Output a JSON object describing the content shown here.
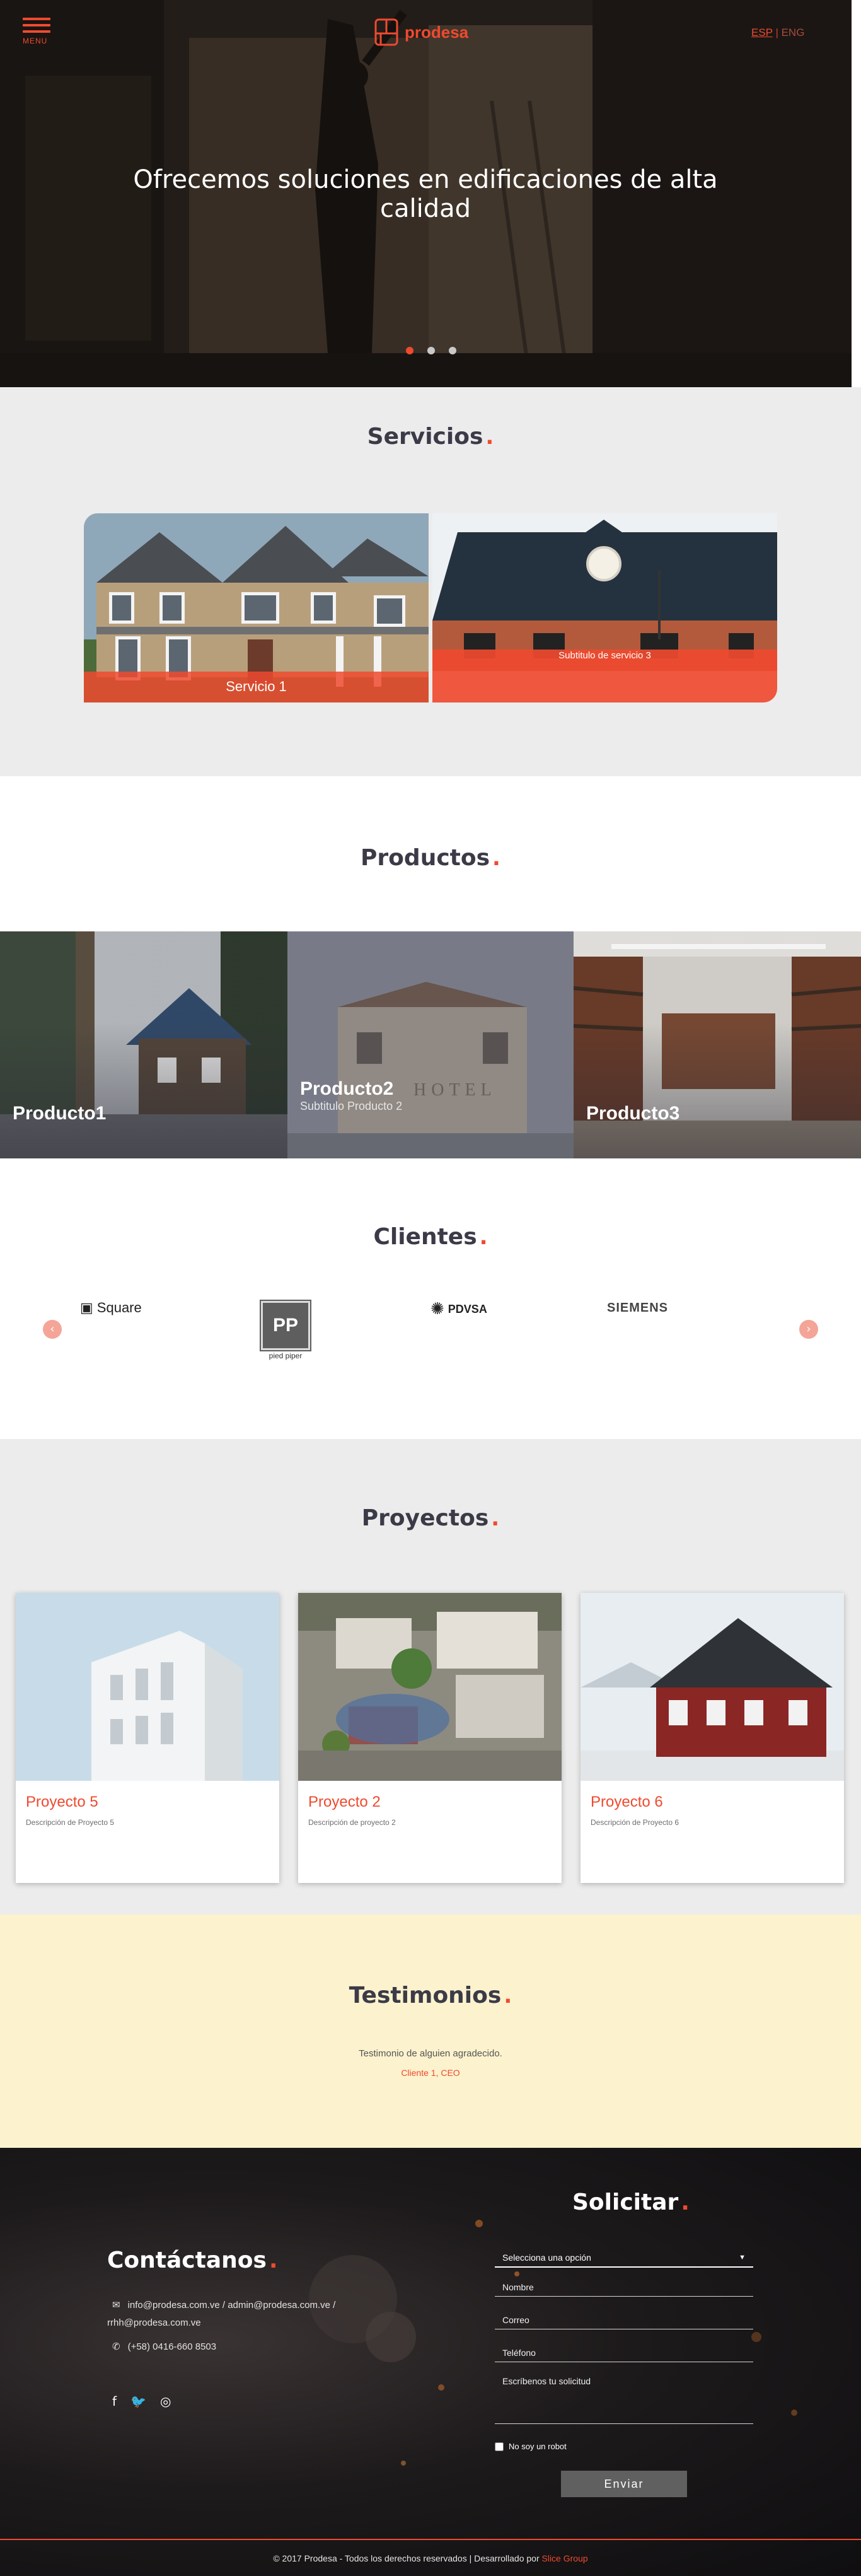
{
  "header": {
    "menu_label": "MENU",
    "brand_name": "prodesa",
    "lang_active": "ESP",
    "lang_separator": " | ",
    "lang_other": "ENG"
  },
  "hero": {
    "title": "Ofrecemos soluciones en edificaciones de alta calidad",
    "slides": 3,
    "active_slide": 1
  },
  "servicios": {
    "title": "Servicios",
    "accent": ".",
    "items": [
      {
        "label": "Servicio 1"
      },
      {
        "label": "Subtitulo de servicio 3"
      }
    ]
  },
  "productos": {
    "title": "Productos",
    "accent": ".",
    "items": [
      {
        "name": "Producto1",
        "subtitle": ""
      },
      {
        "name": "Producto2",
        "subtitle": "Subtitulo Producto 2",
        "sign_text": "HOTEL"
      },
      {
        "name": "Producto3",
        "subtitle": ""
      }
    ]
  },
  "clientes": {
    "title": "Clientes",
    "accent": ".",
    "prev_label": "‹",
    "next_label": "›",
    "logos": [
      {
        "name": "Square",
        "mark": "▣"
      },
      {
        "name": "pied piper",
        "mark": "PP"
      },
      {
        "name": "PDVSA",
        "mark": "✺"
      },
      {
        "name": "SIEMENS",
        "mark": ""
      }
    ]
  },
  "proyectos": {
    "title": "Proyectos",
    "accent": ".",
    "items": [
      {
        "title": "Proyecto 5",
        "description": "Descripción de Proyecto 5"
      },
      {
        "title": "Proyecto 2",
        "description": "Descripción de proyecto 2"
      },
      {
        "title": "Proyecto 6",
        "description": "Descripción de Proyecto 6"
      }
    ]
  },
  "testimonios": {
    "title": "Testimonios",
    "accent": ".",
    "quote": "Testimonio de alguien agradecido.",
    "author": "Cliente 1, CEO"
  },
  "contact": {
    "title": "Contáctanos",
    "accent": ".",
    "email_icon": "✉",
    "emails_line1": "info@prodesa.com.ve / admin@prodesa.com.ve /",
    "emails_line2": "rrhh@prodesa.com.ve",
    "phone_icon": "✆",
    "phone": "(+58) 0416-660 8503",
    "social": [
      {
        "icon": "facebook-icon",
        "glyph": "f"
      },
      {
        "icon": "twitter-icon",
        "glyph": "🐦"
      },
      {
        "icon": "instagram-icon",
        "glyph": "◎"
      }
    ]
  },
  "solicitar": {
    "title": "Solicitar",
    "accent": ".",
    "select_value": "Selecciona una opción",
    "caret": "▼",
    "name_placeholder": "Nombre",
    "email_placeholder": "Correo",
    "phone_placeholder": "Teléfono",
    "message_placeholder": "Escríbenos tu solicitud",
    "captcha_label": "No soy un robot",
    "submit_label": "Enviar"
  },
  "footer": {
    "text": "© 2017 Prodesa - Todos los derechos reservados | Desarrollado por ",
    "developer": "Slice Group"
  },
  "colors": {
    "accent": "#ef4a2f",
    "section_gray": "#ececec",
    "testimonials_bg": "#fcf2cd",
    "text_dark": "#3b3b48"
  }
}
